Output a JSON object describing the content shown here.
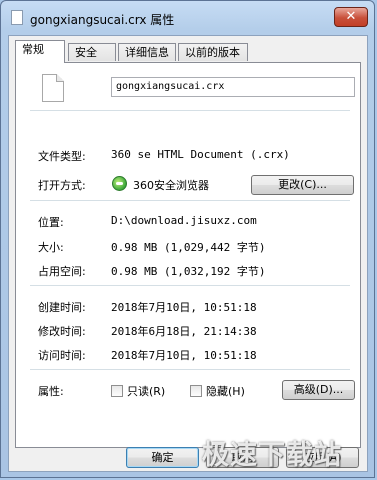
{
  "window": {
    "title": "gongxiangsucai.crx 属性",
    "close_label": "✕"
  },
  "tabs": [
    {
      "label": "常规",
      "active": true
    },
    {
      "label": "安全",
      "active": false
    },
    {
      "label": "详细信息",
      "active": false
    },
    {
      "label": "以前的版本",
      "active": false
    }
  ],
  "general": {
    "file_name": "gongxiangsucai.crx",
    "file_type_label": "文件类型:",
    "file_type_value": "360 se HTML Document (.crx)",
    "open_with_label": "打开方式:",
    "open_with_value": "360安全浏览器",
    "change_button": "更改(C)...",
    "location_label": "位置:",
    "location_value": "D:\\download.jisuxz.com",
    "size_label": "大小:",
    "size_value": "0.98 MB (1,029,442 字节)",
    "size_on_disk_label": "占用空间:",
    "size_on_disk_value": "0.98 MB (1,032,192 字节)",
    "created_label": "创建时间:",
    "created_value": "2018年7月10日, 10:51:18",
    "modified_label": "修改时间:",
    "modified_value": "2018年6月18日, 21:14:38",
    "accessed_label": "访问时间:",
    "accessed_value": "2018年7月10日, 10:51:18",
    "attributes_label": "属性:",
    "readonly_label": "只读(R)",
    "hidden_label": "隐藏(H)",
    "advanced_button": "高级(D)..."
  },
  "footer": {
    "ok_label": "确定",
    "cancel_label": "取消",
    "apply_label": "应用(A)"
  },
  "watermark": "极速下载站",
  "icons": {
    "title_icon": "file-icon",
    "browser_icon": "360-browser-icon"
  }
}
